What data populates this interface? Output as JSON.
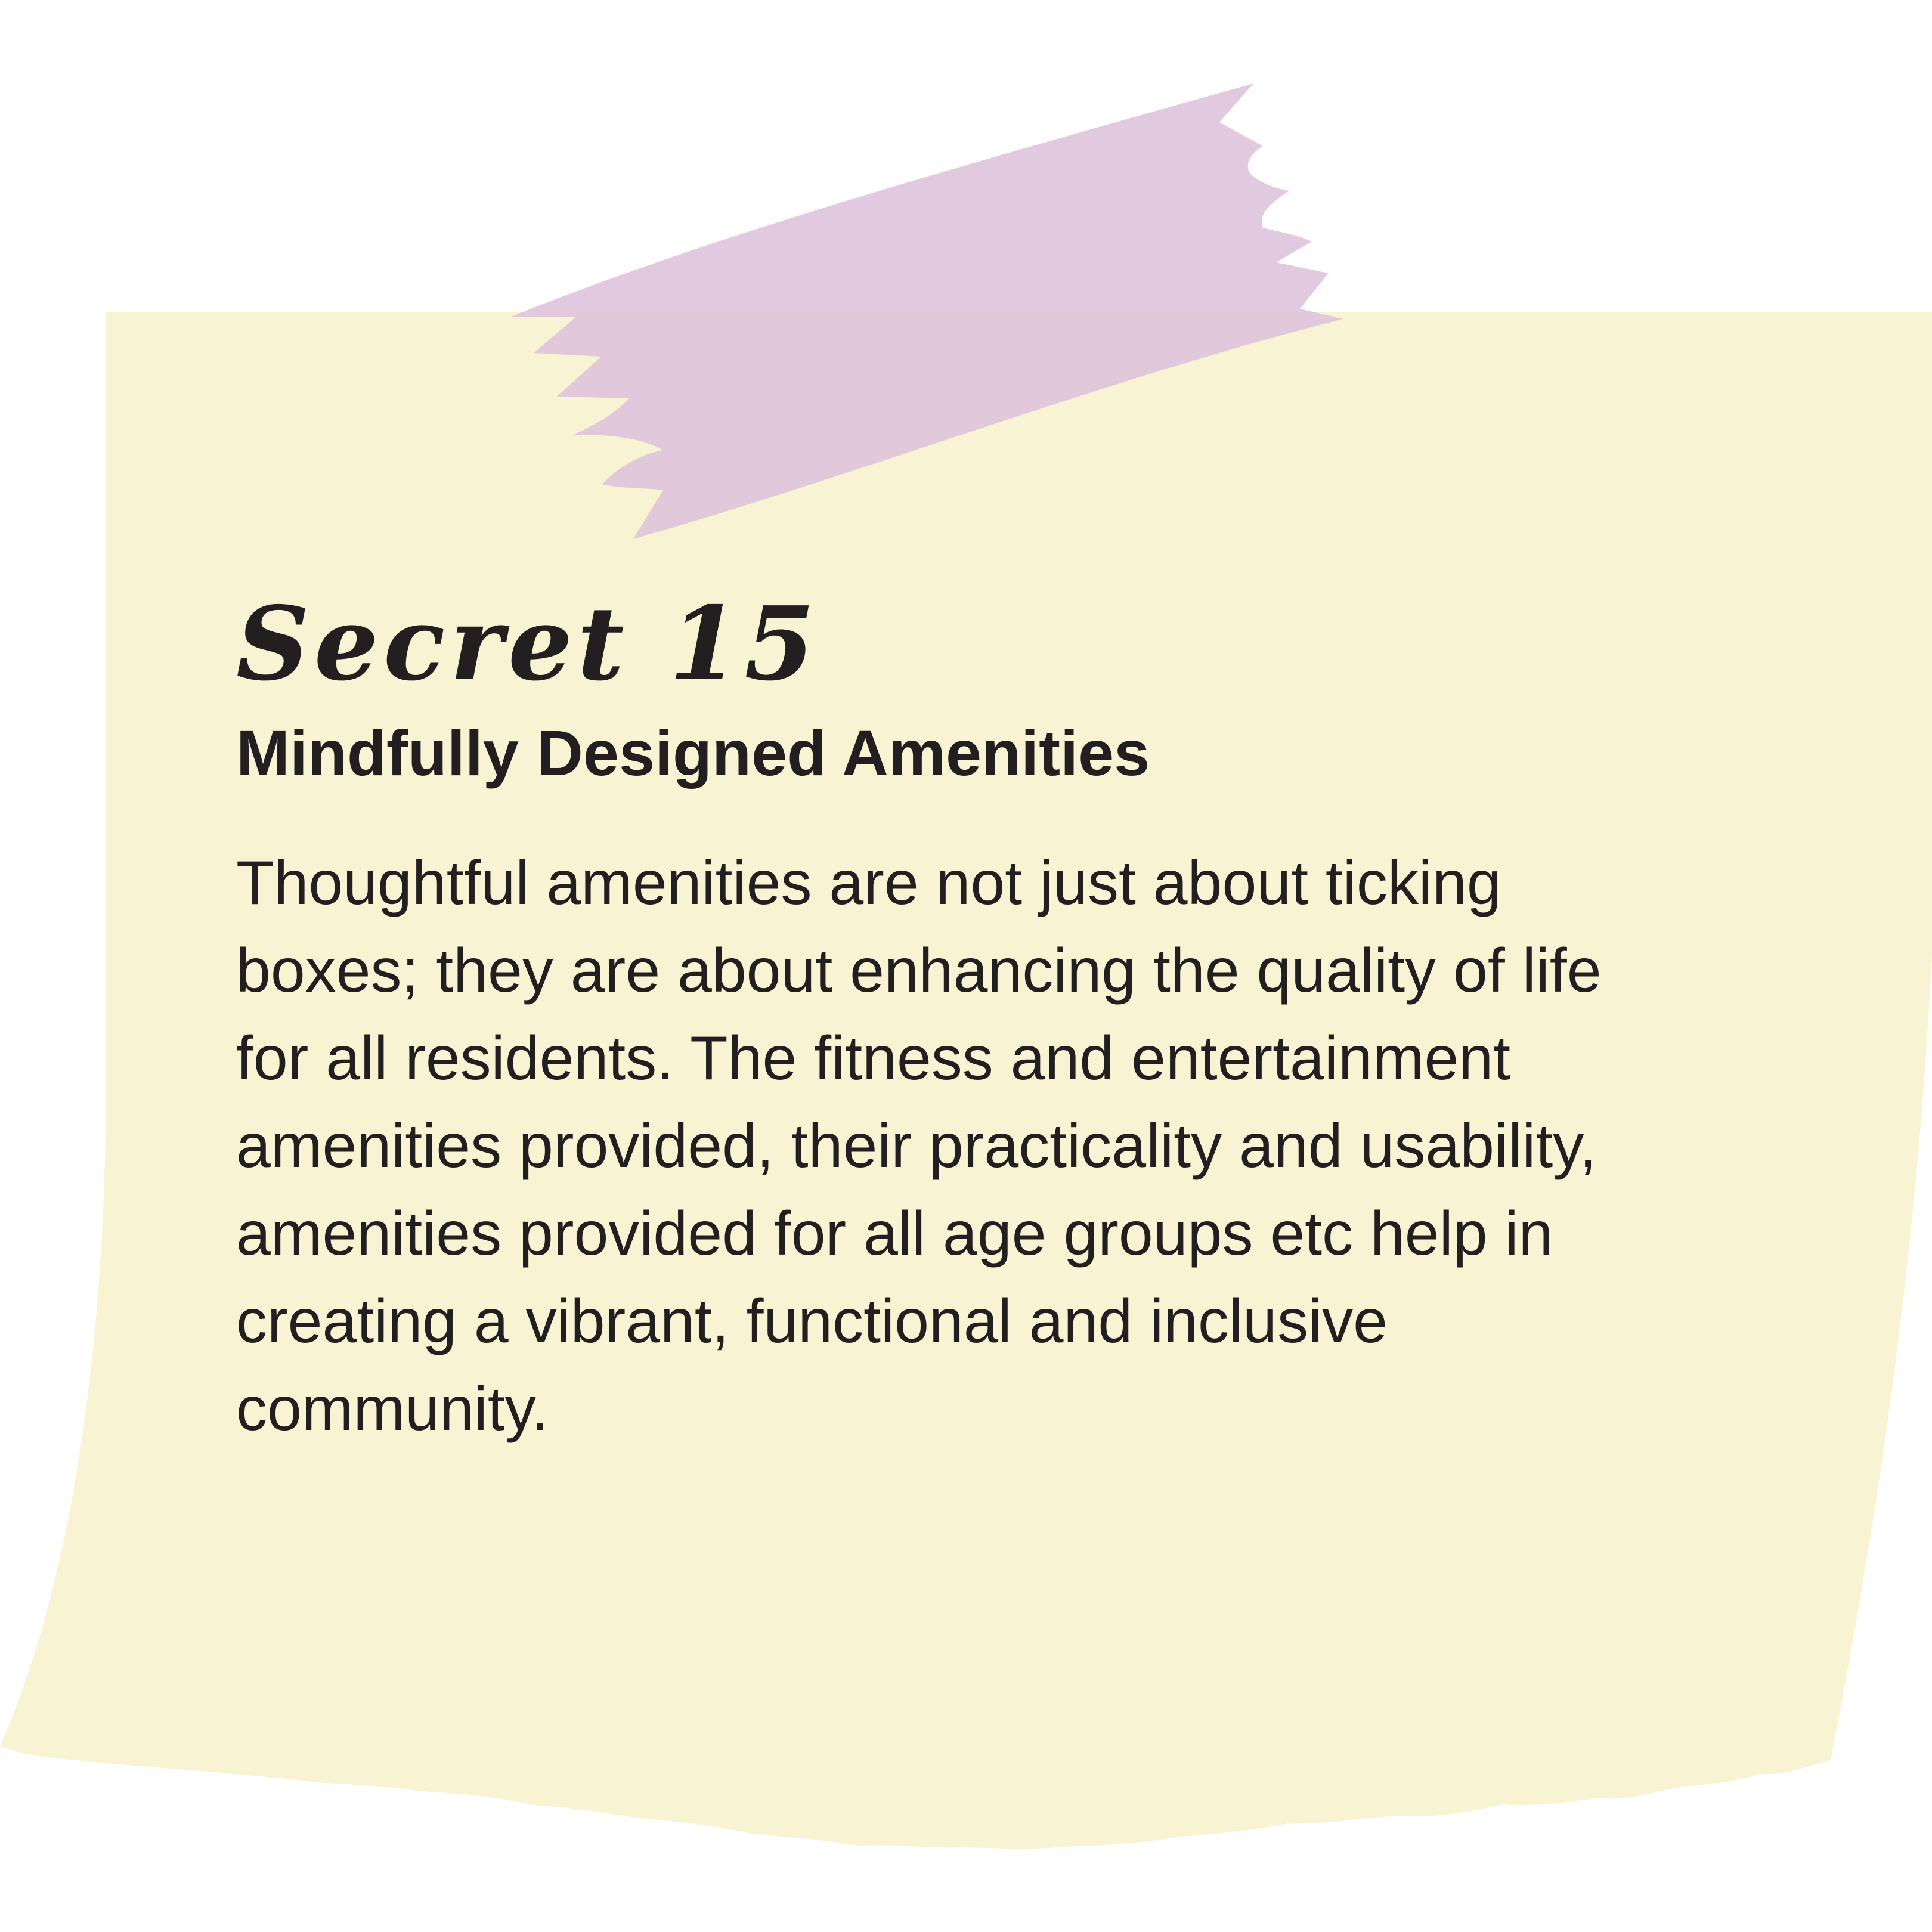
{
  "colors": {
    "background": "#ffffff",
    "note": "#f8f3d2",
    "tape": "#ddc3dc",
    "text": "#231f20"
  },
  "note": {
    "heading": "Secret 15",
    "subheading": "Mindfully Designed Amenities",
    "body_lines": [
      "Thoughtful amenities are not just about ticking",
      "boxes; they are about enhancing the quality of life",
      "for all residents. The fitness and entertainment",
      "amenities provided, their practicality and usability,",
      "amenities provided for all age groups etc help in",
      "creating a vibrant, functional and inclusive",
      "community."
    ]
  }
}
